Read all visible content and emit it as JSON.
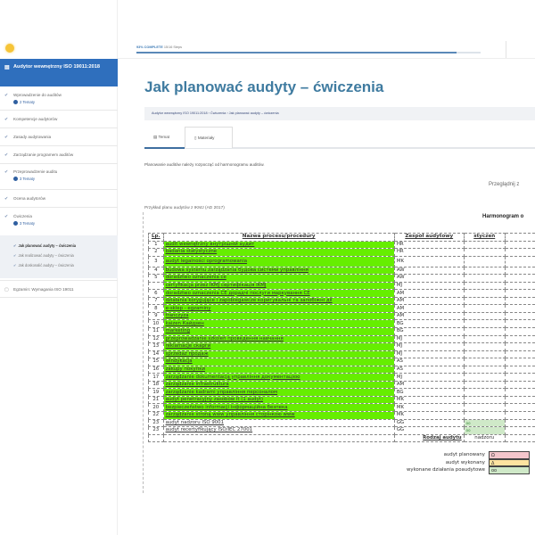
{
  "sidebar": {
    "course_title": "Audytor wewnętrzny ISO 19011:2018",
    "items": [
      {
        "label": "Wprowadzenie do auditów",
        "sub": "2 Tematy"
      },
      {
        "label": "Kompetencje audytorów"
      },
      {
        "label": "Zasady audytowania"
      },
      {
        "label": "Zarządzanie programem auditów"
      },
      {
        "label": "Przeprowadzenie auditu",
        "sub": "3 Tematy"
      },
      {
        "label": "Ocena audytorów"
      },
      {
        "label": "Ćwiczenia",
        "sub": "3 Tematy"
      }
    ],
    "subitems": [
      "Jak planować audyty – ćwiczenia",
      "Jak realizować audyty – ćwiczenia",
      "Jak doskonalić audyty – ćwiczenia"
    ],
    "exam": "Egzamin: Wymagania ISO 19011"
  },
  "progress": {
    "percent_label": "93% COMPLETE",
    "steps": "15/16 Steps",
    "value": 93
  },
  "page": {
    "title": "Jak planować audyty – ćwiczenia",
    "breadcrumb": "Audytor wewnętrzny ISO 19011:2018 › Ćwiczenia › Jak planować audyty – ćwiczenia",
    "tabs": [
      "Temat",
      "Materiały"
    ],
    "intro": "Planowanie auditów należy rozpocząć od harmonogramu auditów.",
    "browse": "Przeglądnij z",
    "caption": "Przykład planu audytów z IKMJ (AD 2017)"
  },
  "sheet": {
    "heading": "Harmonogram o",
    "headers": [
      "Lp.",
      "Nazwa procesu/procedury",
      "Zespół audytowy",
      "styczeń"
    ],
    "rows": [
      [
        "1",
        "audit wewnętrzny  внутрішній аудит",
        "HR",
        ""
      ],
      [
        "2",
        "badania statystyczne",
        "HR",
        ""
      ],
      [
        "3",
        "audyt legalności oprogramowania",
        "MK",
        ""
      ],
      [
        "4",
        "budowa systemu zarządzania  будова системи управління",
        "AW",
        ""
      ],
      [
        "5",
        "doradztwo oznaczenia ce",
        "AW",
        ""
      ],
      [
        "",
        "certyfikacja przez IKMJ  сертифікація IKMJ",
        "MJ",
        ""
      ],
      [
        "6",
        "doradztwo oznaczenia CE  дорадчі послуги маркування CE",
        "AM",
        ""
      ],
      [
        "7",
        "działania korygujące i zapobiegawcze  коригувальні та запобіжні дії",
        "AM",
        ""
      ],
      [
        "8",
        "e-sklep - egzaminy",
        "AM",
        ""
      ],
      [
        "9",
        "franczyza",
        "AM",
        ""
      ],
      [
        "10",
        "kaizen  Кайдзен",
        "BG",
        ""
      ],
      [
        "11",
        "marketing",
        "BG",
        ""
      ],
      [
        "12",
        "przeprowadzanie szkoleń  проведення навчання",
        "MJ",
        ""
      ],
      [
        "13",
        "reklamacje  скарги",
        "MJ",
        ""
      ],
      [
        "14",
        "sprzedaż  продаж",
        "MJ",
        ""
      ],
      [
        "15",
        "windykacja",
        "AS",
        ""
      ],
      [
        "16",
        "zakupy  покупки",
        "AS",
        ""
      ],
      [
        "17",
        "zarządzanie dokumentacją  управління документацією",
        "MJ",
        ""
      ],
      [
        "18",
        "zarządzanie infrastruktura",
        "AM",
        ""
      ],
      [
        "19",
        "zarządzanie kadrami  управління персоналом",
        "BG",
        ""
      ],
      [
        "21",
        "audyt penetracyjny zasobów it (1 audyt)",
        "MK",
        ""
      ],
      [
        "20",
        "bezpieczeństwo informacji  інформаційна безпека",
        "MK",
        ""
      ],
      [
        "22",
        "zarządzanie stroną www  управління сторінкою www",
        "MK",
        ""
      ],
      [
        "23",
        "audyt nadzoru ISO 9001",
        "GG",
        "oo"
      ],
      [
        "23",
        "audyt recertyfikujący ISO/IEC 27001",
        "GG",
        "oo"
      ]
    ],
    "green_rows": 23,
    "footer": {
      "label": "Rodzaj audytu",
      "value": "nadzoru"
    },
    "legend": [
      {
        "label": "audyt planowany",
        "symbol": "Ω",
        "color": "#f4c6cc"
      },
      {
        "label": "audyt wykonany",
        "symbol": "Δ",
        "color": "#fde3a0"
      },
      {
        "label": "wykonane działania poaudytowe",
        "symbol": "oo",
        "color": "#cfe9c8"
      }
    ]
  }
}
